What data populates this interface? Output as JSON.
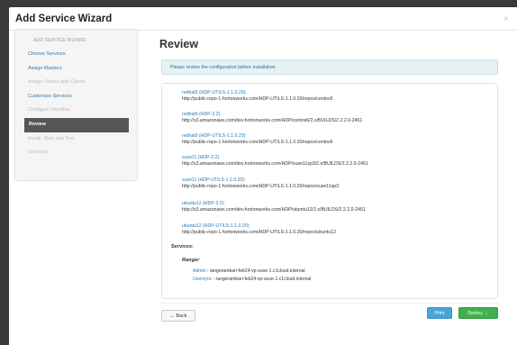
{
  "modal": {
    "title": "Add Service Wizard",
    "close": "x"
  },
  "sidebar": {
    "header": "ADD SERVICE WIZARD",
    "steps": [
      {
        "label": "Choose Services",
        "state": "link"
      },
      {
        "label": "Assign Masters",
        "state": "link"
      },
      {
        "label": "Assign Slaves and Clients",
        "state": "disabled"
      },
      {
        "label": "Customize Services",
        "state": "link"
      },
      {
        "label": "Configure Identities",
        "state": "disabled"
      },
      {
        "label": "Review",
        "state": "active"
      },
      {
        "label": "Install, Start and Test",
        "state": "disabled"
      },
      {
        "label": "Summary",
        "state": "disabled"
      }
    ]
  },
  "main": {
    "title": "Review",
    "alert": "Please review the configuration before installation",
    "repos": [
      {
        "name": "redhat5 (HDP-UTILS-1.1.0.20):",
        "url": "http://public-repo-1.hortonworks.com/HDP-UTILS-1.1.0.20/repos/centos5"
      },
      {
        "name": "redhat6 (HDP-2.2):",
        "url": "http://s3.amazonaws.com/dev.hortonworks.com/HDP/centos6/2.x/BUILDS/2.2.2.0-2451"
      },
      {
        "name": "redhat6 (HDP-UTILS-1.1.0.20):",
        "url": "http://public-repo-1.hortonworks.com/HDP-UTILS-1.1.0.20/repos/centos6"
      },
      {
        "name": "suse11 (HDP-2.2):",
        "url": "http://s3.amazonaws.com/dev.hortonworks.com/HDP/suse11sp3/2.x/BUILDS/2.2.2.0-2451"
      },
      {
        "name": "suse11 (HDP-UTILS-1.1.0.20):",
        "url": "http://public-repo-1.hortonworks.com/HDP-UTILS-1.1.0.20/repos/suse11sp3"
      },
      {
        "name": "ubuntu12 (HDP-2.2):",
        "url": "http://s3.amazonaws.com/dev.hortonworks.com/HDP/ubuntu12/2.x/BUILDS/2.2.2.0-2451"
      },
      {
        "name": "ubuntu12 (HDP-UTILS-1.1.0.20):",
        "url": "http://public-repo-1.hortonworks.com/HDP-UTILS-1.1.0.20/repos/ubuntu12"
      }
    ],
    "services_label": "Services:",
    "service": {
      "name": "Ranger",
      "components": [
        {
          "label": "Admin",
          "host": " : rangerambari-feb24-vp-suse-1.c1cloud.internal"
        },
        {
          "label": "Usersync",
          "host": " : rangerambari-feb24-vp-suse-1.c1cloud.internal"
        }
      ]
    }
  },
  "footer": {
    "back": "← Back",
    "print": "Print",
    "deploy": "Deploy →"
  }
}
